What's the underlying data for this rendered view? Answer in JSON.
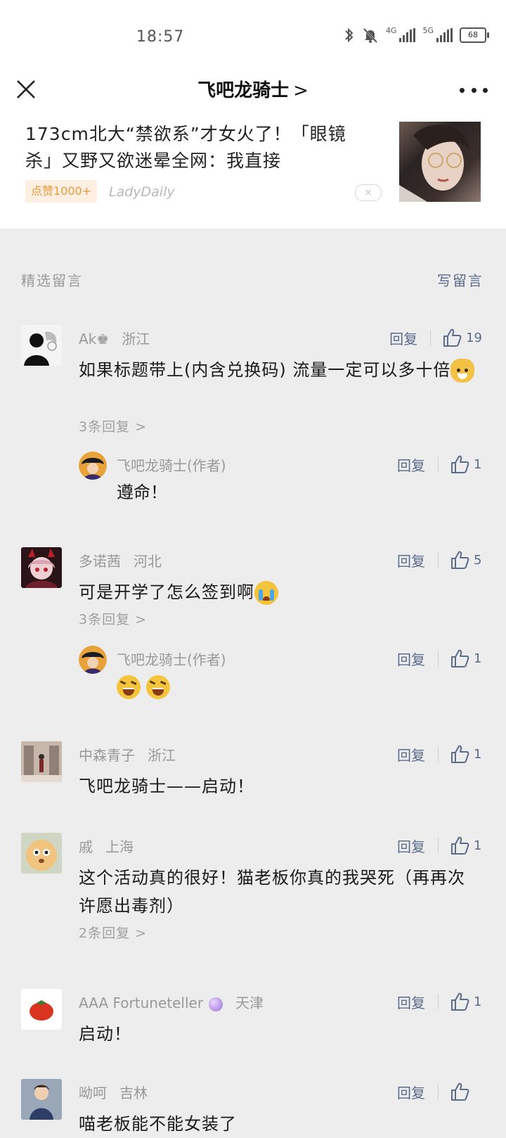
{
  "status_bar": {
    "time": "18:57",
    "network_1": "4G",
    "network_2": "5G",
    "battery": "68"
  },
  "nav": {
    "title": "飞吧龙骑士",
    "chevron": ">"
  },
  "recommend": {
    "title": "173cm北大“禁欲系”才女火了！「眼镜杀」又野又欲迷晕全网：我直接",
    "badge": "点赞1000+",
    "source": "LadyDaily",
    "dismiss": "×"
  },
  "section": {
    "label": "精选留言",
    "write_label": "写留言"
  },
  "reply_label": "回复",
  "comments": [
    {
      "name": "Ak♚",
      "location": "浙江",
      "text": "如果标题带上(内含兑换码) 流量一定可以多十倍",
      "likes": "19",
      "more": "3条回复 >",
      "reply": {
        "name": "飞吧龙骑士(作者)",
        "text": "遵命！",
        "likes": "1"
      }
    },
    {
      "name": "多诺茜",
      "location": "河北",
      "text": "可是开学了怎么签到啊",
      "likes": "5",
      "more": "3条回复 >",
      "reply": {
        "name": "飞吧龙骑士(作者)",
        "text": "",
        "likes": "1"
      }
    },
    {
      "name": "中森青子",
      "location": "浙江",
      "text": "飞吧龙骑士——启动！",
      "likes": "1"
    },
    {
      "name": "戚",
      "location": "上海",
      "text": "这个活动真的很好！猫老板你真的我哭死（再再次许愿出毒剂）",
      "likes": "1",
      "more": "2条回复 >"
    },
    {
      "name": "AAA Fortuneteller",
      "location": "天津",
      "text": "启动！",
      "likes": "1"
    },
    {
      "name": "呦呵",
      "location": "吉林",
      "text": "喵老板能不能女装了",
      "likes": ""
    }
  ],
  "colors": {
    "link": "#5a6b8c",
    "muted": "#999999",
    "background": "#ededed",
    "badge_text": "#e79a3c"
  }
}
